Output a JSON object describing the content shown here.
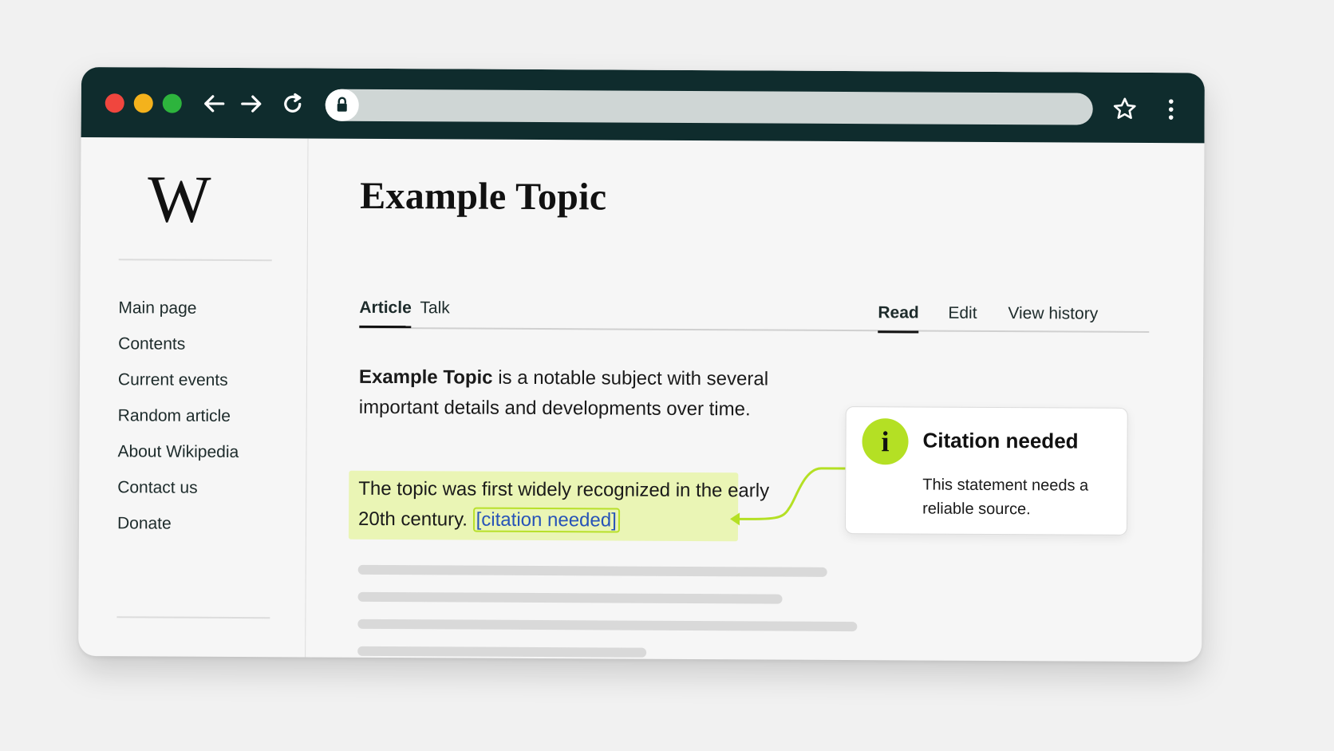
{
  "browser": {
    "icons": {
      "back": "back-arrow-icon",
      "forward": "forward-arrow-icon",
      "reload": "reload-icon",
      "lock": "lock-icon",
      "bookmark": "star-icon",
      "menu": "kebab-menu-icon"
    },
    "colors": {
      "titlebar": "#0f2c2d",
      "close": "#f0463e",
      "minimize": "#f4b21c",
      "maximize": "#2db43d"
    }
  },
  "sidebar": {
    "logo": "W",
    "nav": [
      "Main page",
      "Contents",
      "Current events",
      "Random article",
      "About Wikipedia",
      "Contact us",
      "Donate"
    ]
  },
  "page": {
    "title": "Example Topic",
    "tabs_left": [
      "Article",
      "Talk"
    ],
    "tabs_right": [
      "Read",
      "Edit",
      "View history"
    ],
    "active_left_tab": "Article",
    "active_right_tab": "Read",
    "intro_bold": "Example Topic",
    "intro_rest": " is a notable subject with several important details and developments over time.",
    "highlight_text": "The topic was first widely recognized in the early 20th century. ",
    "citation_link": "[citation needed]",
    "highlight_color": "#eaf5b5",
    "accent_color": "#b4e024",
    "link_color": "#2753b8"
  },
  "popup": {
    "icon": "info-icon",
    "icon_glyph": "i",
    "title": "Citation needed",
    "body": "This statement needs a reliable source."
  }
}
